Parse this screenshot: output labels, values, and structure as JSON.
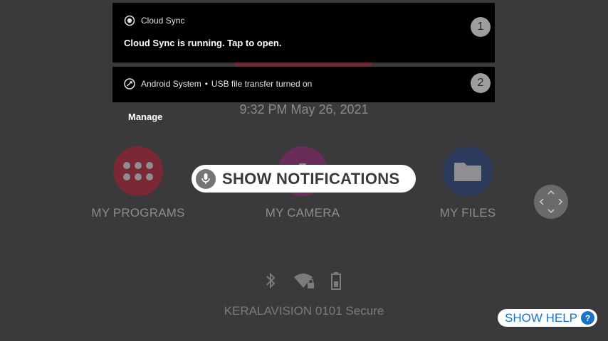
{
  "notifications": [
    {
      "app_name": "Cloud Sync",
      "body": "Cloud Sync is running. Tap to open.",
      "index": "1",
      "icon": "gear-sync-icon"
    },
    {
      "app_name": "Android System",
      "separator": "•",
      "detail": "USB file transfer turned on",
      "index": "2",
      "icon": "usb-icon"
    }
  ],
  "manage_label": "Manage",
  "clock": "9:32 PM May 26, 2021",
  "apps": [
    {
      "label": "MY PROGRAMS",
      "color": "#7a2833",
      "icon": "grid-dots-icon"
    },
    {
      "label": "MY CAMERA",
      "color": "#6a2c58",
      "icon": "camera-icon"
    },
    {
      "label": "MY FILES",
      "color": "#2c3b5c",
      "icon": "folder-icon"
    }
  ],
  "voice_prompt": "SHOW NOTIFICATIONS",
  "network": "KERALAVISION 0101 Secure",
  "help_label": "SHOW HELP",
  "help_icon_text": "?",
  "status_icons": [
    "bluetooth-icon",
    "wifi-lock-icon",
    "battery-icon"
  ]
}
